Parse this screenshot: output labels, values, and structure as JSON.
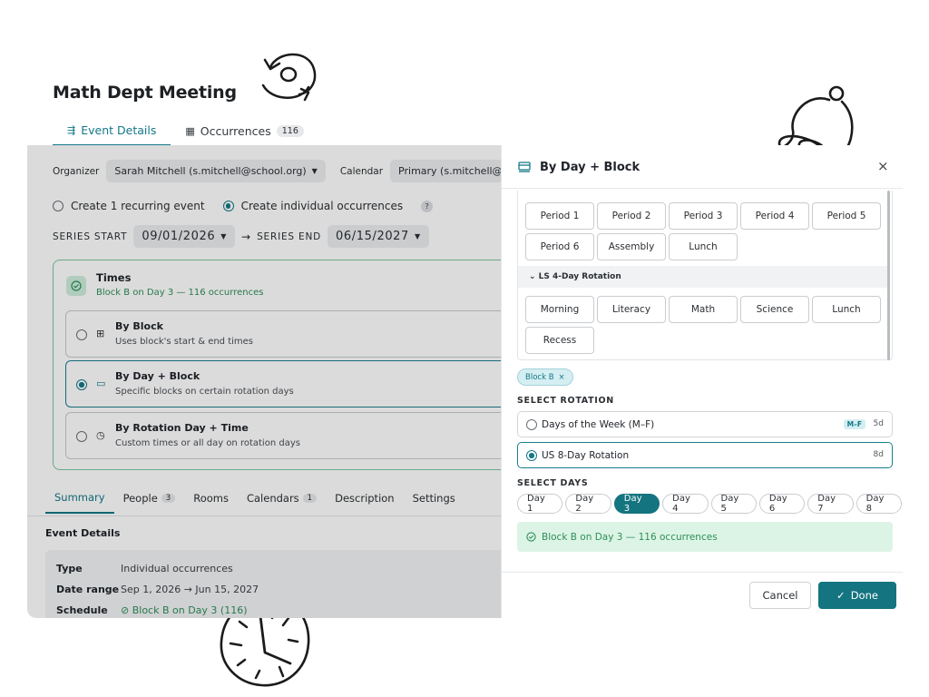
{
  "page": {
    "title": "Math Dept Meeting"
  },
  "top_tabs": [
    {
      "label": "Event Details",
      "icon": "sliders-icon",
      "active": true
    },
    {
      "label": "Occurrences",
      "icon": "calendar-icon",
      "count": "116"
    }
  ],
  "form": {
    "organizer_label": "Organizer",
    "organizer_value": "Sarah Mitchell (s.mitchell@school.org)",
    "calendar_label": "Calendar",
    "calendar_value": "Primary (s.mitchell@school",
    "mode_options": [
      "Create 1 recurring event",
      "Create individual occurrences"
    ],
    "mode_selected": "Create individual occurrences",
    "help": "?",
    "series_start_label": "SERIES START",
    "series_start_value": "09/01/2026",
    "arrow": "→",
    "series_end_label": "SERIES END",
    "series_end_value": "06/15/2027"
  },
  "times": {
    "title": "Times",
    "subtitle": "Block B on Day 3 — 116 occurrences",
    "options": [
      {
        "title": "By Block",
        "desc": "Uses block's start & end times",
        "icon": "grid-icon",
        "selected": false
      },
      {
        "title": "By Day + Block",
        "desc": "Specific blocks on certain rotation days",
        "icon": "window-icon",
        "selected": true
      },
      {
        "title": "By Rotation Day + Time",
        "desc": "Custom times or all day on rotation days",
        "icon": "clock-icon",
        "selected": false
      }
    ]
  },
  "sub_tabs": [
    {
      "label": "Summary",
      "active": true
    },
    {
      "label": "People",
      "count": "3"
    },
    {
      "label": "Rooms"
    },
    {
      "label": "Calendars",
      "count": "1"
    },
    {
      "label": "Description"
    },
    {
      "label": "Settings"
    }
  ],
  "event_details": {
    "heading": "Event Details",
    "rows": [
      {
        "key": "Type",
        "value": "Individual occurrences"
      },
      {
        "key": "Date range",
        "value": "Sep 1, 2026 → Jun 15, 2027"
      },
      {
        "key": "Schedule",
        "value": "⊘ Block B on Day 3 (116)"
      }
    ]
  },
  "drawer": {
    "title": "By Day + Block",
    "close": "×",
    "blocks_row1": [
      "Period 1",
      "Period 2",
      "Period 3",
      "Period 4",
      "Period 5"
    ],
    "blocks_row2": [
      "Period 6",
      "Assembly",
      "Lunch"
    ],
    "group_label": "⌄ LS 4-Day Rotation",
    "blocks_row3": [
      "Morning",
      "Literacy",
      "Math",
      "Science",
      "Lunch"
    ],
    "blocks_row4": [
      "Recess"
    ],
    "chip_label": "Block B",
    "chip_remove": "×",
    "select_rotation_label": "SELECT ROTATION",
    "rotations": [
      {
        "label": "Days of the Week (M–F)",
        "tag": "M–F",
        "length": "5d",
        "selected": false
      },
      {
        "label": "US 8-Day Rotation",
        "length": "8d",
        "selected": true
      }
    ],
    "select_days_label": "SELECT DAYS",
    "days": [
      "Day 1",
      "Day 2",
      "Day 3",
      "Day 4",
      "Day 5",
      "Day 6",
      "Day 7",
      "Day 8"
    ],
    "selected_day": "Day 3",
    "summary": "Block B on Day 3 — 116 occurrences",
    "cancel_label": "Cancel",
    "done_label": "Done"
  },
  "colors": {
    "accent": "#14747f",
    "success": "#2d8f5a",
    "success_bg": "#dcf4e5"
  }
}
